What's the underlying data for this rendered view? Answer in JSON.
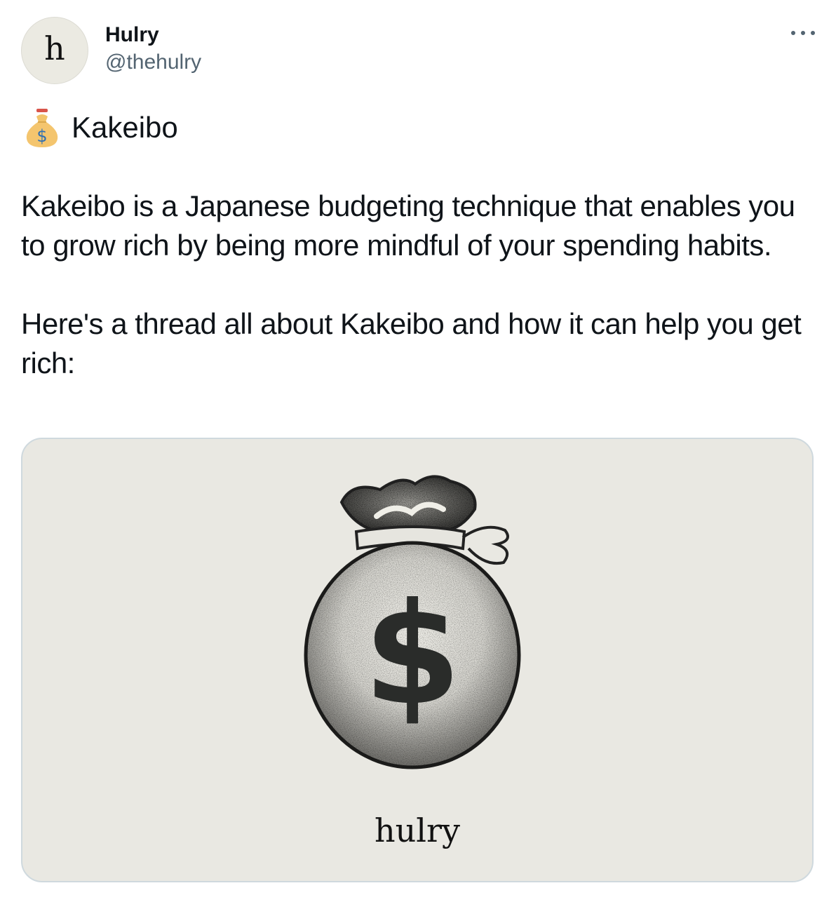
{
  "author": {
    "avatar_letter": "h",
    "display_name": "Hulry",
    "handle": "@thehulry"
  },
  "tweet": {
    "headline_icon": "money-bag-icon",
    "headline": "Kakeibo",
    "paragraphs": [
      "Kakeibo is a Japanese budgeting technique that enables you to grow rich by being more mindful of your spending habits.",
      "Here's a thread all about Kakeibo and how it can help you get rich:"
    ]
  },
  "media": {
    "icon": "money-bag-icon",
    "symbol": "$",
    "brand_text": "hulry",
    "background_color": "#e9e8e2"
  },
  "menu": {
    "icon": "more-icon"
  }
}
